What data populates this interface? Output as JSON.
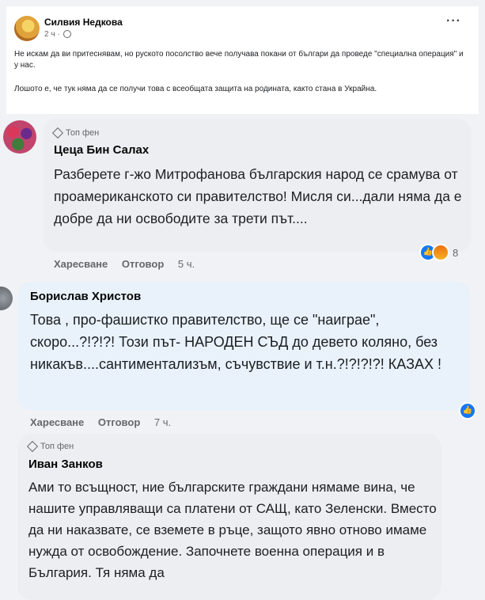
{
  "post": {
    "author": "Силвия Недкова",
    "meta": "2 ч ·",
    "paragraph1": "Не искам да ви притеснявам, но руското посолство вече получава покани от българи да проведе \"специална операция\" и у нас.",
    "paragraph2": "Лошото е, че тук няма да се получи това с всеобщата защита на родината, както стана в Украйна.",
    "more": "···"
  },
  "comments": [
    {
      "badge": "Топ фен",
      "author": "Цеца Бин Салах",
      "text": "Разберете г-жо Митрофанова българския народ се срамува от проамериканското си правителство! Мисля си...дали няма да е добре да ни освободите за трети път....",
      "like": "Харесване",
      "reply": "Отговор",
      "time": "5 ч.",
      "reactions": "8"
    },
    {
      "author": "Борислав Христов",
      "text": "Това , про-фашистко правителство, ще се \"наиграе\", скоро...?!?!?! Този път- НАРОДЕН СЪД до девето коляно, без никакъв....сантиментализъм, съчувствие и т.н.?!?!?!?! КАЗАХ !",
      "like": "Харесване",
      "reply": "Отговор",
      "time": "7 ч."
    },
    {
      "badge": "Топ фен",
      "author": "Иван Занков",
      "text": "Ами то всъщност, ние българските граждани нямаме вина, че нашите управляващи са платени от САЩ, като Зеленски. Вместо да ни наказвате, се вземете в ръце, защото явно отново имаме нужда от освобождение. Започнете военна операция и в България. Тя няма да"
    }
  ],
  "icons": {
    "like": "thumbs-up-icon",
    "angry": "angry-face-icon",
    "diamond": "diamond-icon",
    "globe": "globe-icon"
  }
}
